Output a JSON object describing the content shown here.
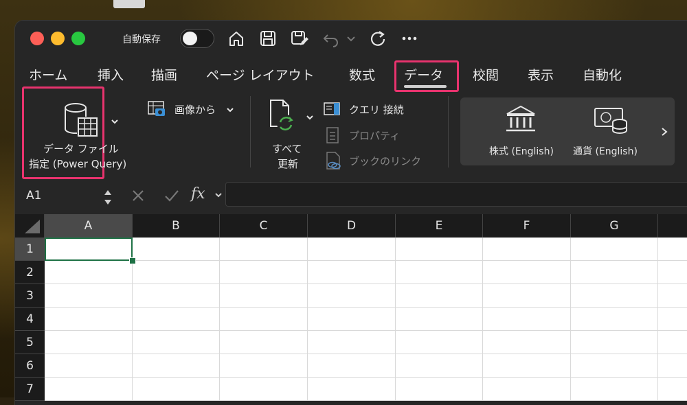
{
  "titlebar": {
    "autosave_label": "自動保存",
    "icons": [
      "home-icon",
      "save-icon",
      "save-as-icon",
      "undo-icon",
      "chevron-down-icon",
      "redo-icon",
      "more-icon"
    ]
  },
  "tabs": [
    {
      "label": "ホーム"
    },
    {
      "label": "挿入"
    },
    {
      "label": "描画"
    },
    {
      "label": "ページ レイアウト"
    },
    {
      "label": "数式"
    },
    {
      "label": "データ",
      "selected": true
    },
    {
      "label": "校閲"
    },
    {
      "label": "表示"
    },
    {
      "label": "自動化"
    }
  ],
  "ribbon": {
    "power_query": {
      "line1": "データ ファイル",
      "line2": "指定 (Power Query)"
    },
    "from_picture": "画像から",
    "refresh_all": {
      "line1": "すべて",
      "line2": "更新"
    },
    "queries_connections": "クエリ  接続",
    "properties": "プロパティ",
    "workbook_links": "ブックのリンク",
    "stocks": "株式 (English)",
    "currencies": "通貨 (English)"
  },
  "formula_bar": {
    "name_box": "A1",
    "fx_label": "fx",
    "value": ""
  },
  "grid": {
    "columns": [
      "A",
      "B",
      "C",
      "D",
      "E",
      "F",
      "G"
    ],
    "rows": [
      "1",
      "2",
      "3",
      "4",
      "5",
      "6",
      "7"
    ],
    "selected_cell": "A1"
  },
  "colors": {
    "highlight": "#e8336e",
    "selection": "#1e7145",
    "background": "#262626"
  }
}
